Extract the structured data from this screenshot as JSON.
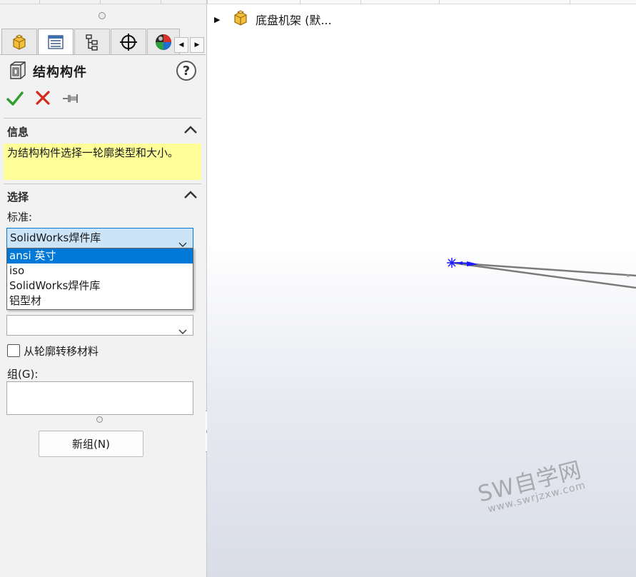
{
  "panel": {
    "title": "结构构件",
    "help_label": "?",
    "tabs": [
      "featuremanager-tab",
      "propertymanager-tab",
      "configurationmanager-tab",
      "dimxpert-tab",
      "display-manager-tab"
    ],
    "info": {
      "title": "信息",
      "text": "为结构构件选择一轮廓类型和大小。"
    },
    "selection": {
      "title": "选择",
      "standard_label": "标准:",
      "standard_value": "SolidWorks焊件库",
      "options": [
        "ansi 英寸",
        "iso",
        "SolidWorks焊件库",
        "铝型材"
      ],
      "selected_option": "ansi 英寸",
      "size_value": "",
      "transfer_material_label": "从轮廓转移材料",
      "transfer_material_checked": false,
      "group_label": "组(G):",
      "new_group_button": "新组(N)"
    }
  },
  "viewport": {
    "tree_item": "底盘机架  (默..."
  },
  "watermark": {
    "main": "SW自学网",
    "sub": "www.swrjzxw.com"
  },
  "colors": {
    "accent": "#0078d7",
    "info_bg": "#ffff99",
    "ok_green": "#2e9e2e",
    "cancel_red": "#d42a1c",
    "sketch_blue": "#1a1aff",
    "sketch_line": "#7a7a7a"
  }
}
